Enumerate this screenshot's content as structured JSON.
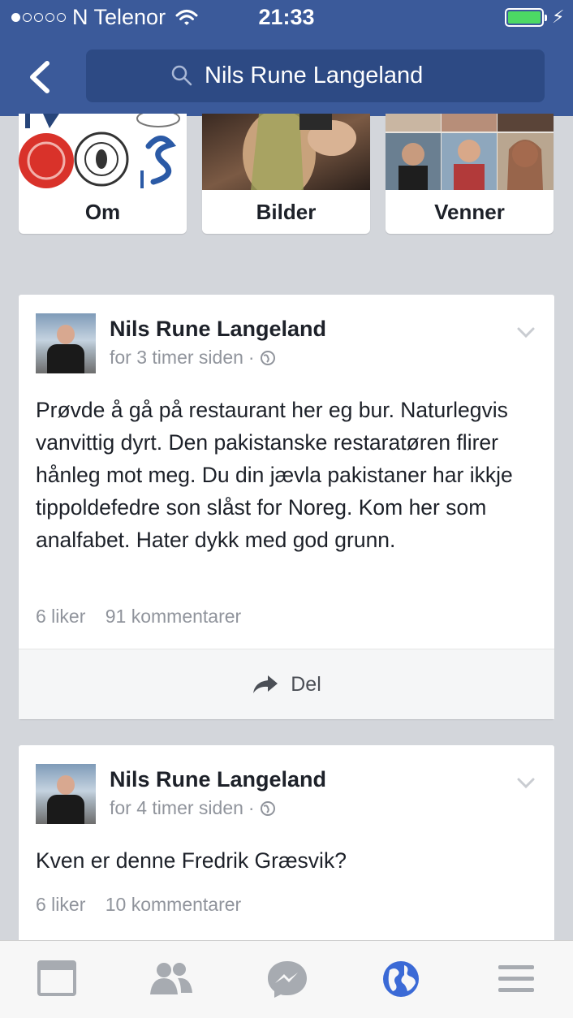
{
  "status_bar": {
    "carrier": "N Telenor",
    "time": "21:33",
    "battery_color": "#4cd964"
  },
  "header": {
    "back_icon": "chevron-left-icon",
    "search_icon": "search-icon",
    "search_text": "Nils Rune Langeland"
  },
  "tiles": [
    {
      "label": "Om"
    },
    {
      "label": "Bilder"
    },
    {
      "label": "Venner"
    }
  ],
  "posts": [
    {
      "author": "Nils Rune Langeland",
      "time": "for 3 timer siden",
      "privacy_icon": "globe-icon",
      "text": "Prøvde å gå på restaurant her eg bur. Naturlegvis vanvittig dyrt. Den pakistanske restaratøren flirer hånleg mot meg. Du din jævla pakistaner har ikkje tippoldefedre son slåst for Noreg. Kom her som analfabet. Hater dykk med god grunn.",
      "likes": "6 liker",
      "comments": "91 kommentarer",
      "share_label": "Del"
    },
    {
      "author": "Nils Rune Langeland",
      "time": "for 4 timer siden",
      "privacy_icon": "globe-icon",
      "text": "Kven er denne Fredrik Græsvik?",
      "likes": "6 liker",
      "comments": "10 kommentarer"
    }
  ],
  "bottom_nav": {
    "items": [
      "news-feed-icon",
      "friends-icon",
      "messenger-icon",
      "globe-notifications-icon",
      "menu-icon"
    ],
    "active": "globe-notifications-icon",
    "active_color": "#3b6ad6"
  }
}
